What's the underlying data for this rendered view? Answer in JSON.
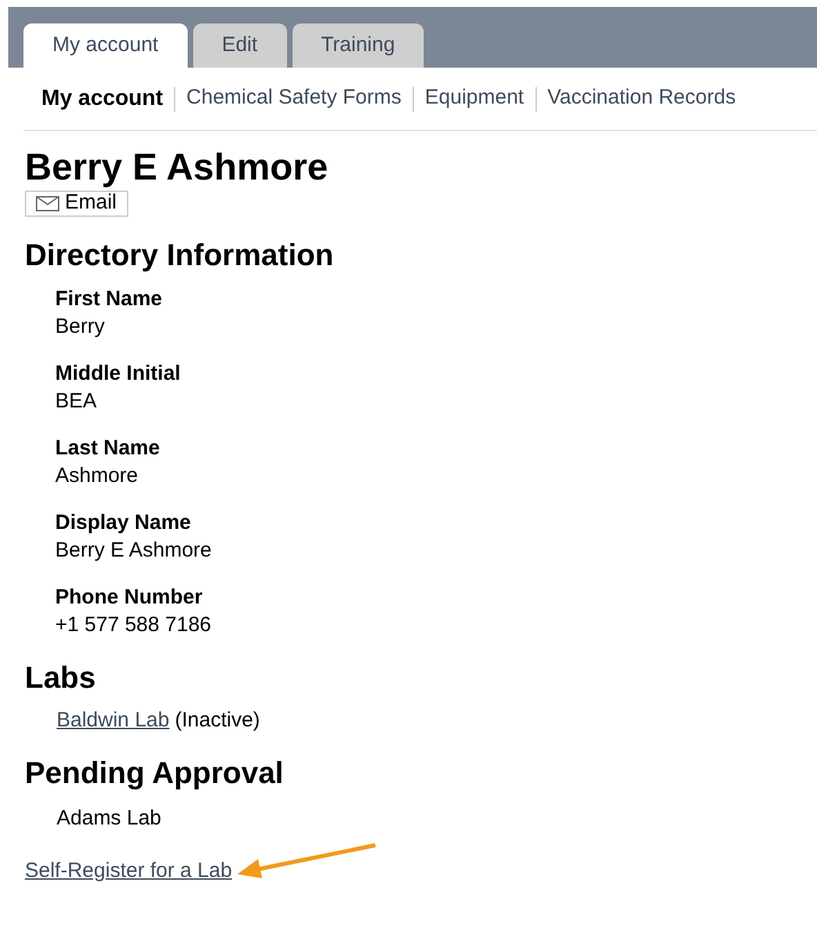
{
  "tabs": [
    {
      "label": "My account",
      "selected": true
    },
    {
      "label": "Edit",
      "selected": false
    },
    {
      "label": "Training",
      "selected": false
    }
  ],
  "subnav": [
    {
      "label": "My account",
      "selected": true
    },
    {
      "label": "Chemical Safety Forms",
      "selected": false
    },
    {
      "label": "Equipment",
      "selected": false
    },
    {
      "label": "Vaccination Records",
      "selected": false
    }
  ],
  "name": "Berry E Ashmore",
  "email_button": "Email",
  "directory": {
    "title": "Directory Information",
    "fields": [
      {
        "label": "First Name",
        "value": "Berry"
      },
      {
        "label": "Middle Initial",
        "value": "BEA"
      },
      {
        "label": "Last Name",
        "value": "Ashmore"
      },
      {
        "label": "Display Name",
        "value": "Berry E Ashmore"
      },
      {
        "label": "Phone Number",
        "value": "+1 577 588 7186"
      }
    ]
  },
  "labs": {
    "title": "Labs",
    "items": [
      {
        "link": "Baldwin Lab",
        "note": "(Inactive)"
      }
    ]
  },
  "pending": {
    "title": "Pending Approval",
    "items": [
      "Adams Lab"
    ]
  },
  "self_register_link": "Self-Register for a Lab"
}
